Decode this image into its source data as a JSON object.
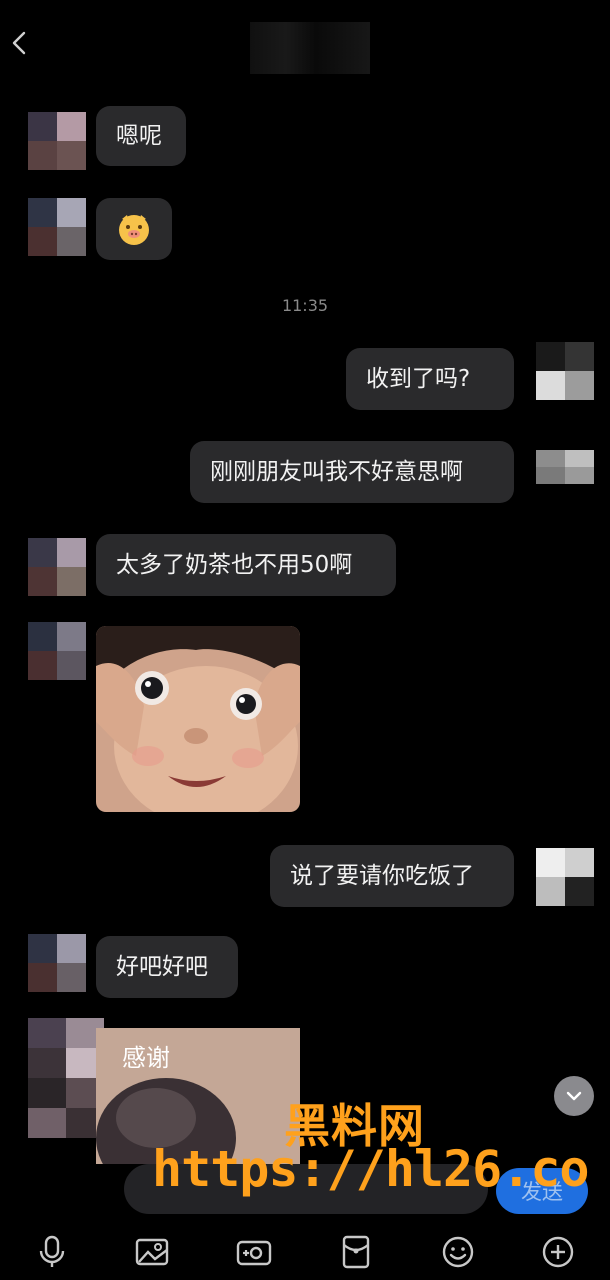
{
  "header": {
    "back_icon": "chevron-left-icon"
  },
  "timestamp": "11:35",
  "messages": [
    {
      "side": "left",
      "text": "嗯呢"
    },
    {
      "side": "left",
      "emoji": "pig-face-emoji"
    },
    {
      "side": "right",
      "text": "收到了吗?"
    },
    {
      "side": "right",
      "text": "刚刚朋友叫我不好意思啊"
    },
    {
      "side": "left",
      "text": "太多了奶茶也不用50啊"
    },
    {
      "side": "left",
      "image": "child-face-sticker"
    },
    {
      "side": "right",
      "text": "说了要请你吃饭了"
    },
    {
      "side": "left",
      "text": "好吧好吧"
    },
    {
      "side": "left",
      "image_caption": "感谢"
    }
  ],
  "input": {
    "send_label": "发送"
  },
  "watermark": {
    "line1": "黑料网",
    "line2": "https://hl26.co"
  },
  "toolbar": [
    "microphone-icon",
    "image-icon",
    "camera-icon",
    "red-packet-icon",
    "emoji-icon",
    "plus-icon"
  ]
}
